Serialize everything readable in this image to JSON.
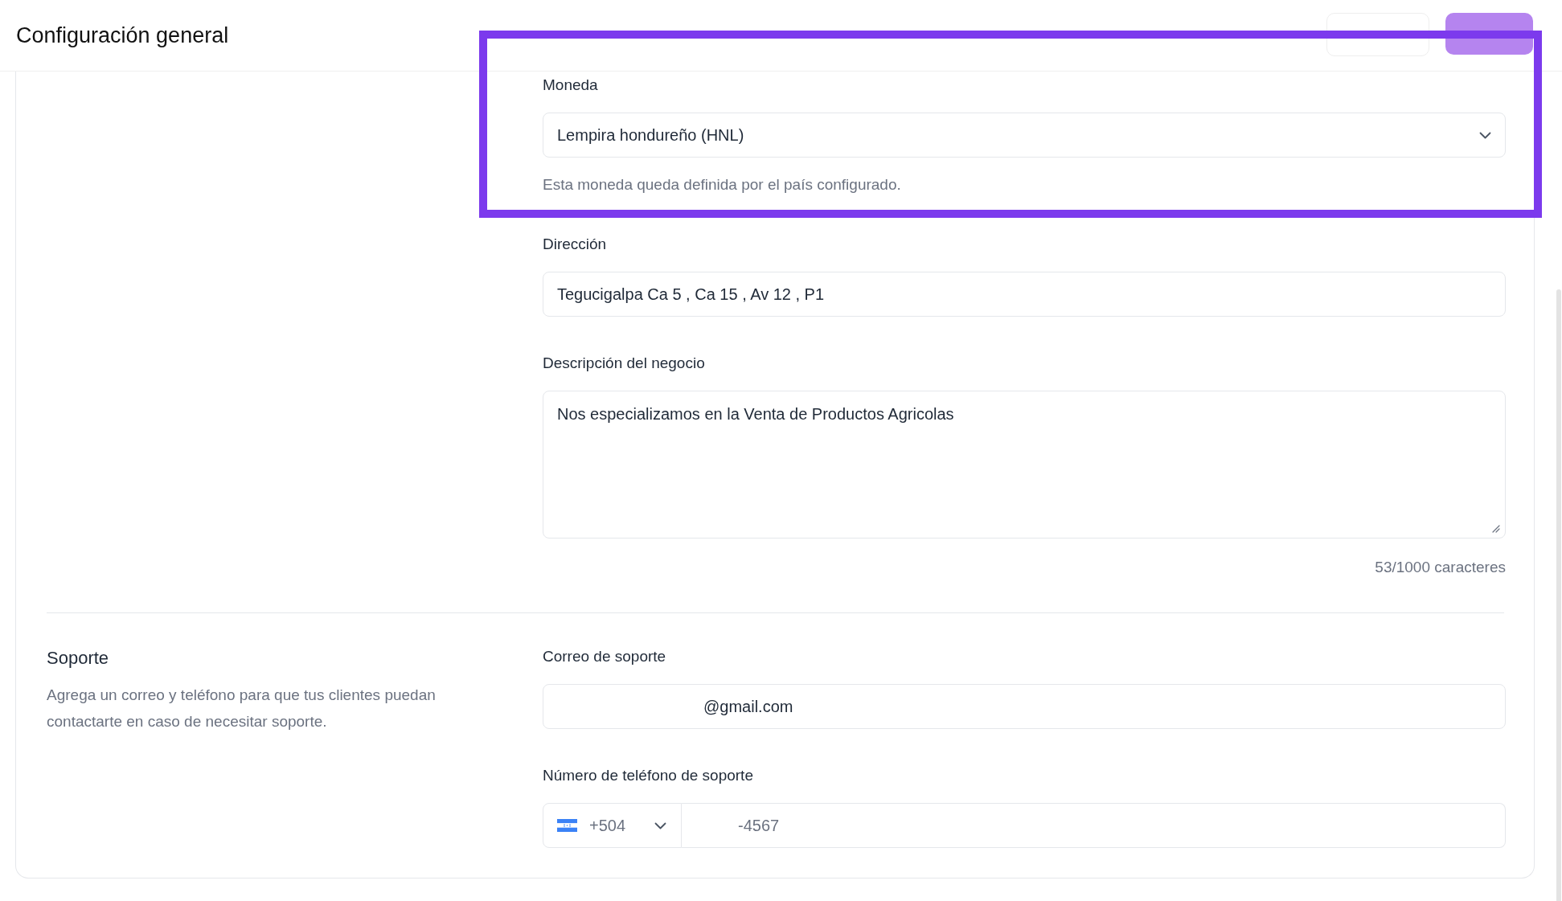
{
  "header": {
    "title": "Configuración general",
    "actions": [
      {
        "kind": "secondary"
      },
      {
        "kind": "primary",
        "disabled": true
      }
    ]
  },
  "annotation": {
    "kind": "frame"
  },
  "sections": [
    {
      "fields": [
        {
          "kind": "select",
          "label": "Moneda",
          "value": "Lempira hondureño (HNL)",
          "hint": "Esta moneda queda definida por el país configurado."
        },
        {
          "kind": "input",
          "label": "Dirección",
          "value": "Tegucigalpa Ca 5 , Ca 15 , Av 12 , P1",
          "masked_prefix": false
        },
        {
          "kind": "textarea",
          "label": "Descripción del negocio",
          "value": "Nos especializamos en la Venta de Productos Agricolas",
          "counter": "53/1000 caracteres"
        }
      ]
    },
    {
      "title": "Soporte",
      "description": "Agrega un correo y teléfono para que tus clientes puedan contactarte en caso de necesitar soporte.",
      "fields": [
        {
          "kind": "input",
          "label": "Correo de soporte",
          "value": "@gmail.com",
          "masked_prefix": true
        },
        {
          "kind": "phone",
          "label": "Número de teléfono de soporte",
          "country_code": "+504",
          "value": "-4567",
          "masked_prefix": true
        }
      ]
    }
  ]
}
